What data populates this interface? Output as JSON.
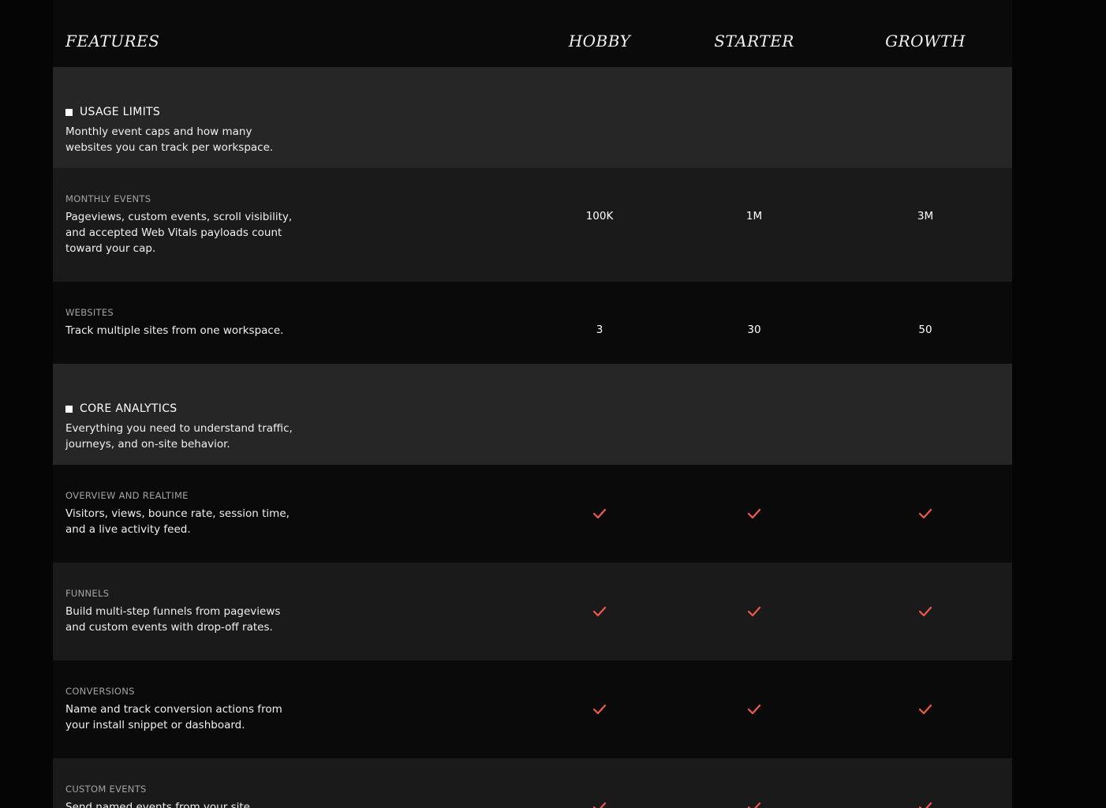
{
  "header": {
    "features": "FEATURES",
    "plans": [
      "HOBBY",
      "STARTER",
      "GROWTH"
    ]
  },
  "accent_color": "#f0574e",
  "sections": [
    {
      "title": "USAGE LIMITS",
      "description": "Monthly event caps and how many websites you can track per workspace.",
      "rows": [
        {
          "name": "MONTHLY EVENTS",
          "description": "Pageviews, custom events, scroll visibility, and accepted Web Vitals payloads count toward your cap.",
          "values": [
            "100K",
            "1M",
            "3M"
          ]
        },
        {
          "name": "WEBSITES",
          "description": "Track multiple sites from one workspace.",
          "values": [
            "3",
            "30",
            "50"
          ]
        }
      ]
    },
    {
      "title": "CORE ANALYTICS",
      "description": "Everything you need to understand traffic, journeys, and on-site behavior.",
      "rows": [
        {
          "name": "OVERVIEW AND REALTIME",
          "description": "Visitors, views, bounce rate, session time, and a live activity feed.",
          "values": [
            "check-icon",
            "check-icon",
            "check-icon"
          ]
        },
        {
          "name": "FUNNELS",
          "description": "Build multi-step funnels from pageviews and custom events with drop-off rates.",
          "values": [
            "check-icon",
            "check-icon",
            "check-icon"
          ]
        },
        {
          "name": "CONVERSIONS",
          "description": "Name and track conversion actions from your install snippet or dashboard.",
          "values": [
            "check-icon",
            "check-icon",
            "check-icon"
          ]
        },
        {
          "name": "CUSTOM EVENTS",
          "description": "Send named events from your site",
          "values": [
            "check-icon",
            "check-icon",
            "check-icon"
          ]
        }
      ]
    }
  ]
}
